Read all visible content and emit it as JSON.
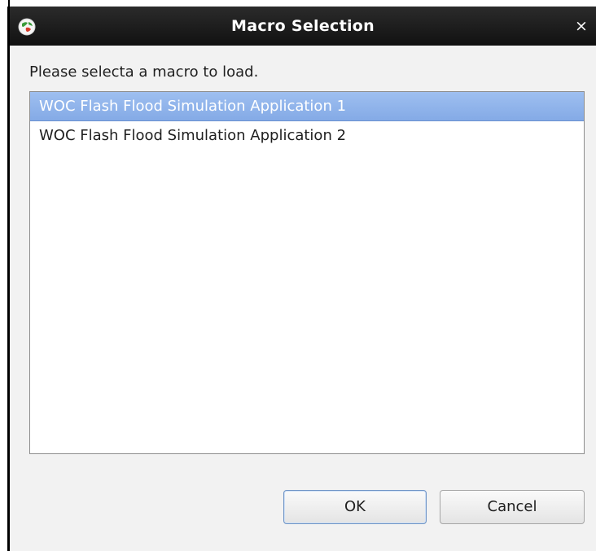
{
  "window": {
    "title": "Macro Selection",
    "close_glyph": "×",
    "app_icon": "app-globe-icon"
  },
  "main": {
    "prompt": "Please selecta a macro to load.",
    "macros": [
      {
        "label": "WOC Flash Flood Simulation Application 1",
        "selected": true
      },
      {
        "label": "WOC Flash Flood Simulation Application 2",
        "selected": false
      }
    ]
  },
  "buttons": {
    "ok_label": "OK",
    "cancel_label": "Cancel"
  },
  "colors": {
    "titlebar": "#1b1b1b",
    "selection": "#8fb3ea",
    "dialog_bg": "#f2f2f2"
  }
}
